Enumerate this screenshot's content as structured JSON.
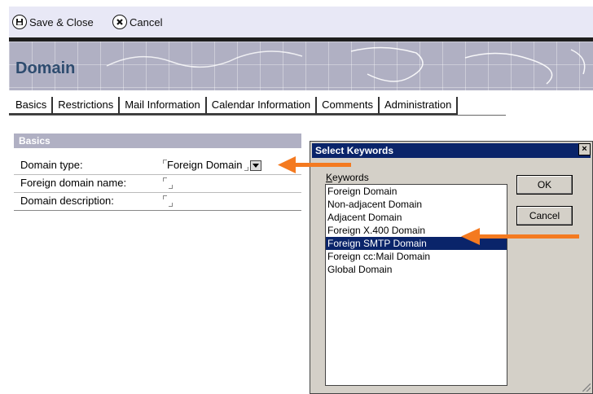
{
  "toolbar": {
    "save_label": "Save & Close",
    "cancel_label": "Cancel"
  },
  "banner": {
    "title": "Domain"
  },
  "tabs": [
    {
      "label": "Basics"
    },
    {
      "label": "Restrictions"
    },
    {
      "label": "Mail Information"
    },
    {
      "label": "Calendar Information"
    },
    {
      "label": "Comments"
    },
    {
      "label": "Administration"
    }
  ],
  "basics": {
    "header": "Basics",
    "rows": [
      {
        "label": "Domain type:",
        "value": "Foreign Domain"
      },
      {
        "label": "Foreign domain name:",
        "value": ""
      },
      {
        "label": "Domain description:",
        "value": ""
      }
    ]
  },
  "dialog": {
    "title": "Select Keywords",
    "keywords_label": "Keywords",
    "ok_label": "OK",
    "cancel_label": "Cancel",
    "items": [
      "Foreign Domain",
      "Non-adjacent Domain",
      "Adjacent Domain",
      "Foreign X.400 Domain",
      "Foreign SMTP Domain",
      "Foreign cc:Mail Domain",
      "Global Domain"
    ],
    "selected_index": 4
  },
  "colors": {
    "toolbar_bg": "#e8e8f6",
    "banner_bg": "#b0b0c3",
    "title_blue": "#2e4c6f",
    "selection": "#0a246a",
    "arrow": "#f47a20"
  }
}
